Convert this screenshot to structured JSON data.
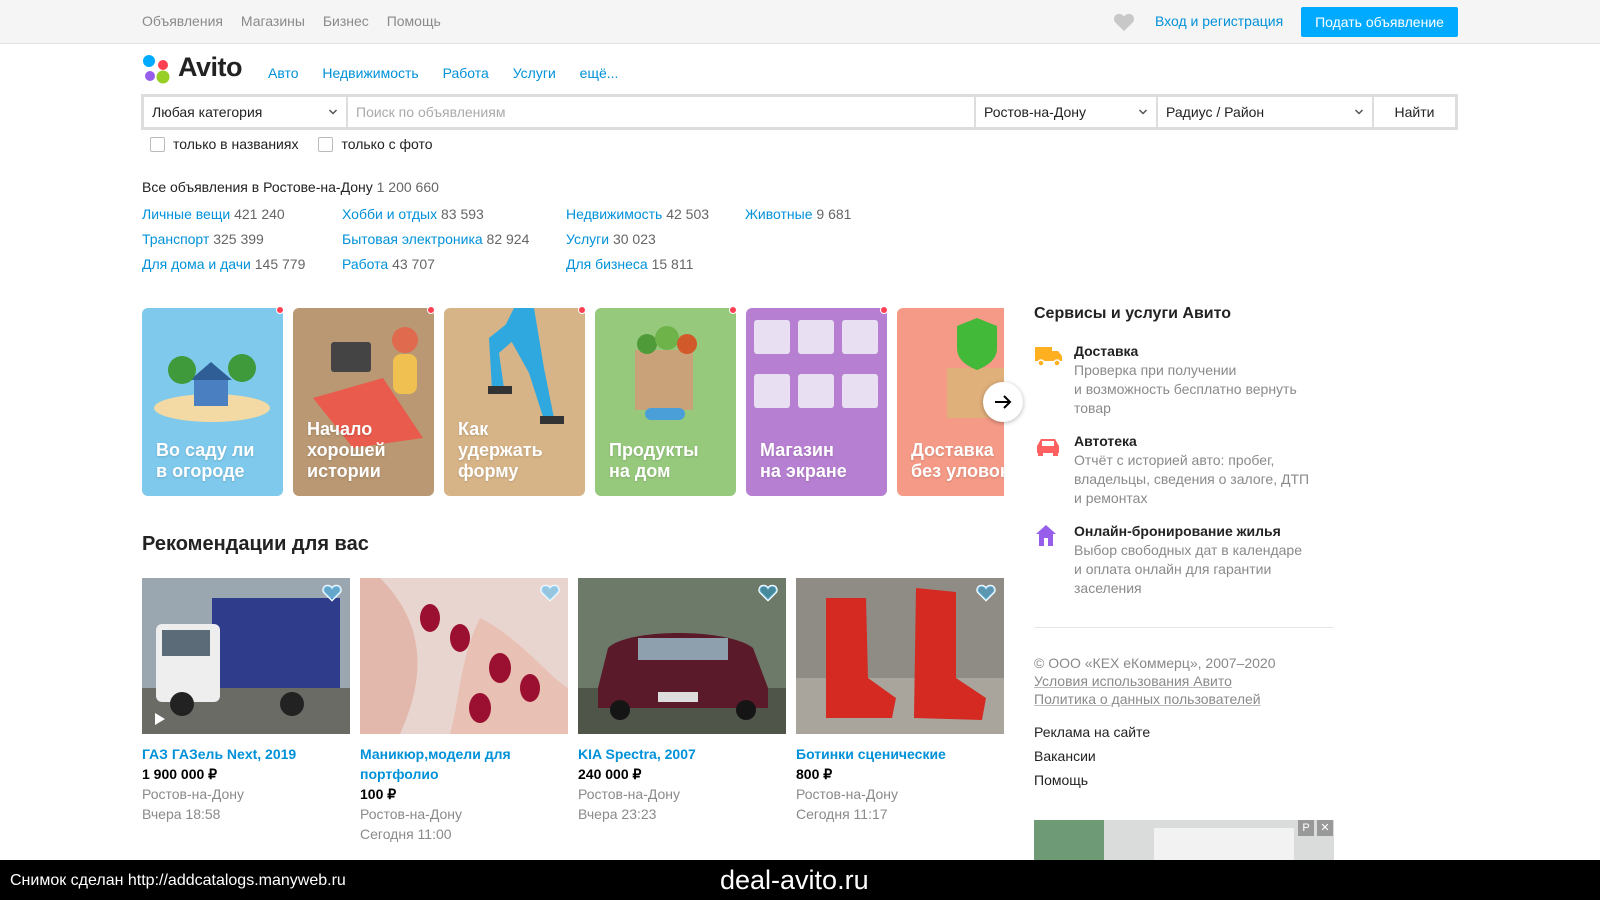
{
  "top": {
    "nav": [
      "Объявления",
      "Магазины",
      "Бизнес",
      "Помощь"
    ],
    "login": "Вход и регистрация",
    "post_button": "Подать объявление"
  },
  "logo": {
    "text": "Avito"
  },
  "catnav": [
    "Авто",
    "Недвижимость",
    "Работа",
    "Услуги",
    "ещё..."
  ],
  "search": {
    "category": "Любая категория",
    "placeholder": "Поиск по объявлениям",
    "city": "Ростов-на-Дону",
    "radius": "Радиус / Район",
    "button": "Найти",
    "only_titles": "только в названиях",
    "only_photo": "только с фото"
  },
  "all_ads": {
    "label": "Все объявления в Ростове-на-Дону",
    "count": "1 200 660"
  },
  "categories": [
    [
      {
        "name": "Личные вещи",
        "count": "421 240"
      },
      {
        "name": "Транспорт",
        "count": "325 399"
      },
      {
        "name": "Для дома и дачи",
        "count": "145 779"
      }
    ],
    [
      {
        "name": "Хобби и отдых",
        "count": "83 593"
      },
      {
        "name": "Бытовая электроника",
        "count": "82 924"
      },
      {
        "name": "Работа",
        "count": "43 707"
      }
    ],
    [
      {
        "name": "Недвижимость",
        "count": "42 503"
      },
      {
        "name": "Услуги",
        "count": "30 023"
      },
      {
        "name": "Для бизнеса",
        "count": "15 811"
      }
    ],
    [
      {
        "name": "Животные",
        "count": "9 681"
      }
    ]
  ],
  "stories": [
    {
      "title": "Во саду ли\nв огороде",
      "color": "#7ec9ec"
    },
    {
      "title": "Начало\nхорошей\nистории",
      "color": "#b99873"
    },
    {
      "title": "Как\nудержать\nформу",
      "color": "#d7b488"
    },
    {
      "title": "Продукты\nна дом",
      "color": "#97c97d"
    },
    {
      "title": "Магазин\nна экране",
      "color": "#b77fd1"
    },
    {
      "title": "Доставка\nбез уловок",
      "color": "#f49a86"
    }
  ],
  "recommendations": {
    "title": "Рекомендации для вас",
    "items": [
      {
        "name": "ГАЗ ГАЗель Next, 2019",
        "price": "1 900 000 ₽",
        "city": "Ростов-на-Дону",
        "date": "Вчера 18:58"
      },
      {
        "name": "Маникюр,модели для портфолио",
        "price": "100 ₽",
        "city": "Ростов-на-Дону",
        "date": "Сегодня 11:00"
      },
      {
        "name": "KIA Spectra, 2007",
        "price": "240 000 ₽",
        "city": "Ростов-на-Дону",
        "date": "Вчера 23:23"
      },
      {
        "name": "Ботинки сценические",
        "price": "800 ₽",
        "city": "Ростов-на-Дону",
        "date": "Сегодня 11:17"
      }
    ]
  },
  "services": {
    "title": "Сервисы и услуги Авито",
    "items": [
      {
        "name": "Доставка",
        "desc": "Проверка при получении\nи возможность бесплатно вернуть\nтовар",
        "icon": "truck-icon",
        "color": "#ffb021"
      },
      {
        "name": "Автотека",
        "desc": "Отчёт с историей авто: пробег,\nвладельцы, сведения о залоге, ДТП\nи ремонтах",
        "icon": "car-icon",
        "color": "#ff6163"
      },
      {
        "name": "Онлайн-бронирование жилья",
        "desc": "Выбор свободных дат в календаре\nи оплата онлайн для гарантии\nзаселения",
        "icon": "house-icon",
        "color": "#965eeb"
      }
    ]
  },
  "footer": {
    "copyright": "© ООО «КЕХ еКоммерц», 2007–2020",
    "terms": "Условия использования Авито",
    "privacy": "Политика о данных пользователей",
    "ads": "Реклама на сайте",
    "jobs": "Вакансии",
    "help": "Помощь"
  },
  "ad_tags": [
    "Р",
    "✕"
  ],
  "bottom_bar": {
    "left": "Снимок сделан http://addcatalogs.manyweb.ru",
    "center": "deal-avito.ru"
  }
}
